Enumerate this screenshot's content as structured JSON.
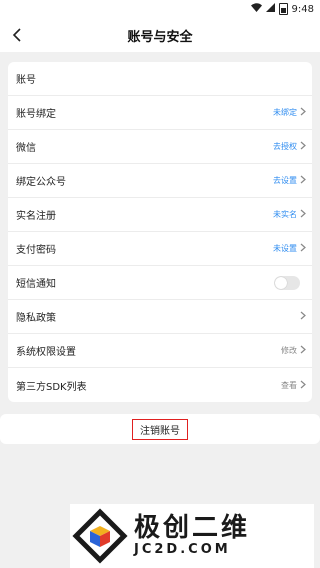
{
  "status_bar": {
    "time": "9:48",
    "icons": [
      "wifi-icon",
      "signal-icon",
      "battery-icon"
    ]
  },
  "header": {
    "title": "账号与安全",
    "back_icon": "chevron-left-icon"
  },
  "colors": {
    "link_blue": "#2f8cf0",
    "muted_gray": "#888888",
    "highlight_red": "#e02020"
  },
  "settings": {
    "rows": [
      {
        "label": "账号",
        "value": "",
        "chevron": false
      },
      {
        "label": "账号绑定",
        "value": "未绑定",
        "value_style": "link",
        "chevron": true
      },
      {
        "label": "微信",
        "value": "去授权",
        "value_style": "link",
        "chevron": true
      },
      {
        "label": "绑定公众号",
        "value": "去设置",
        "value_style": "link",
        "chevron": true
      },
      {
        "label": "实名注册",
        "value": "未实名",
        "value_style": "link",
        "chevron": true
      },
      {
        "label": "支付密码",
        "value": "未设置",
        "value_style": "link",
        "chevron": true
      },
      {
        "label": "短信通知",
        "toggle": true,
        "toggle_on": false
      },
      {
        "label": "隐私政策",
        "value": "",
        "chevron": true
      },
      {
        "label": "系统权限设置",
        "value": "修改",
        "value_style": "muted",
        "chevron": true
      },
      {
        "label": "第三方SDK列表",
        "value": "查看",
        "value_style": "muted",
        "chevron": true
      }
    ]
  },
  "cancel_account": {
    "label": "注销账号"
  },
  "watermark": {
    "title": "极创二维",
    "subtitle": "JC2D.COM"
  }
}
